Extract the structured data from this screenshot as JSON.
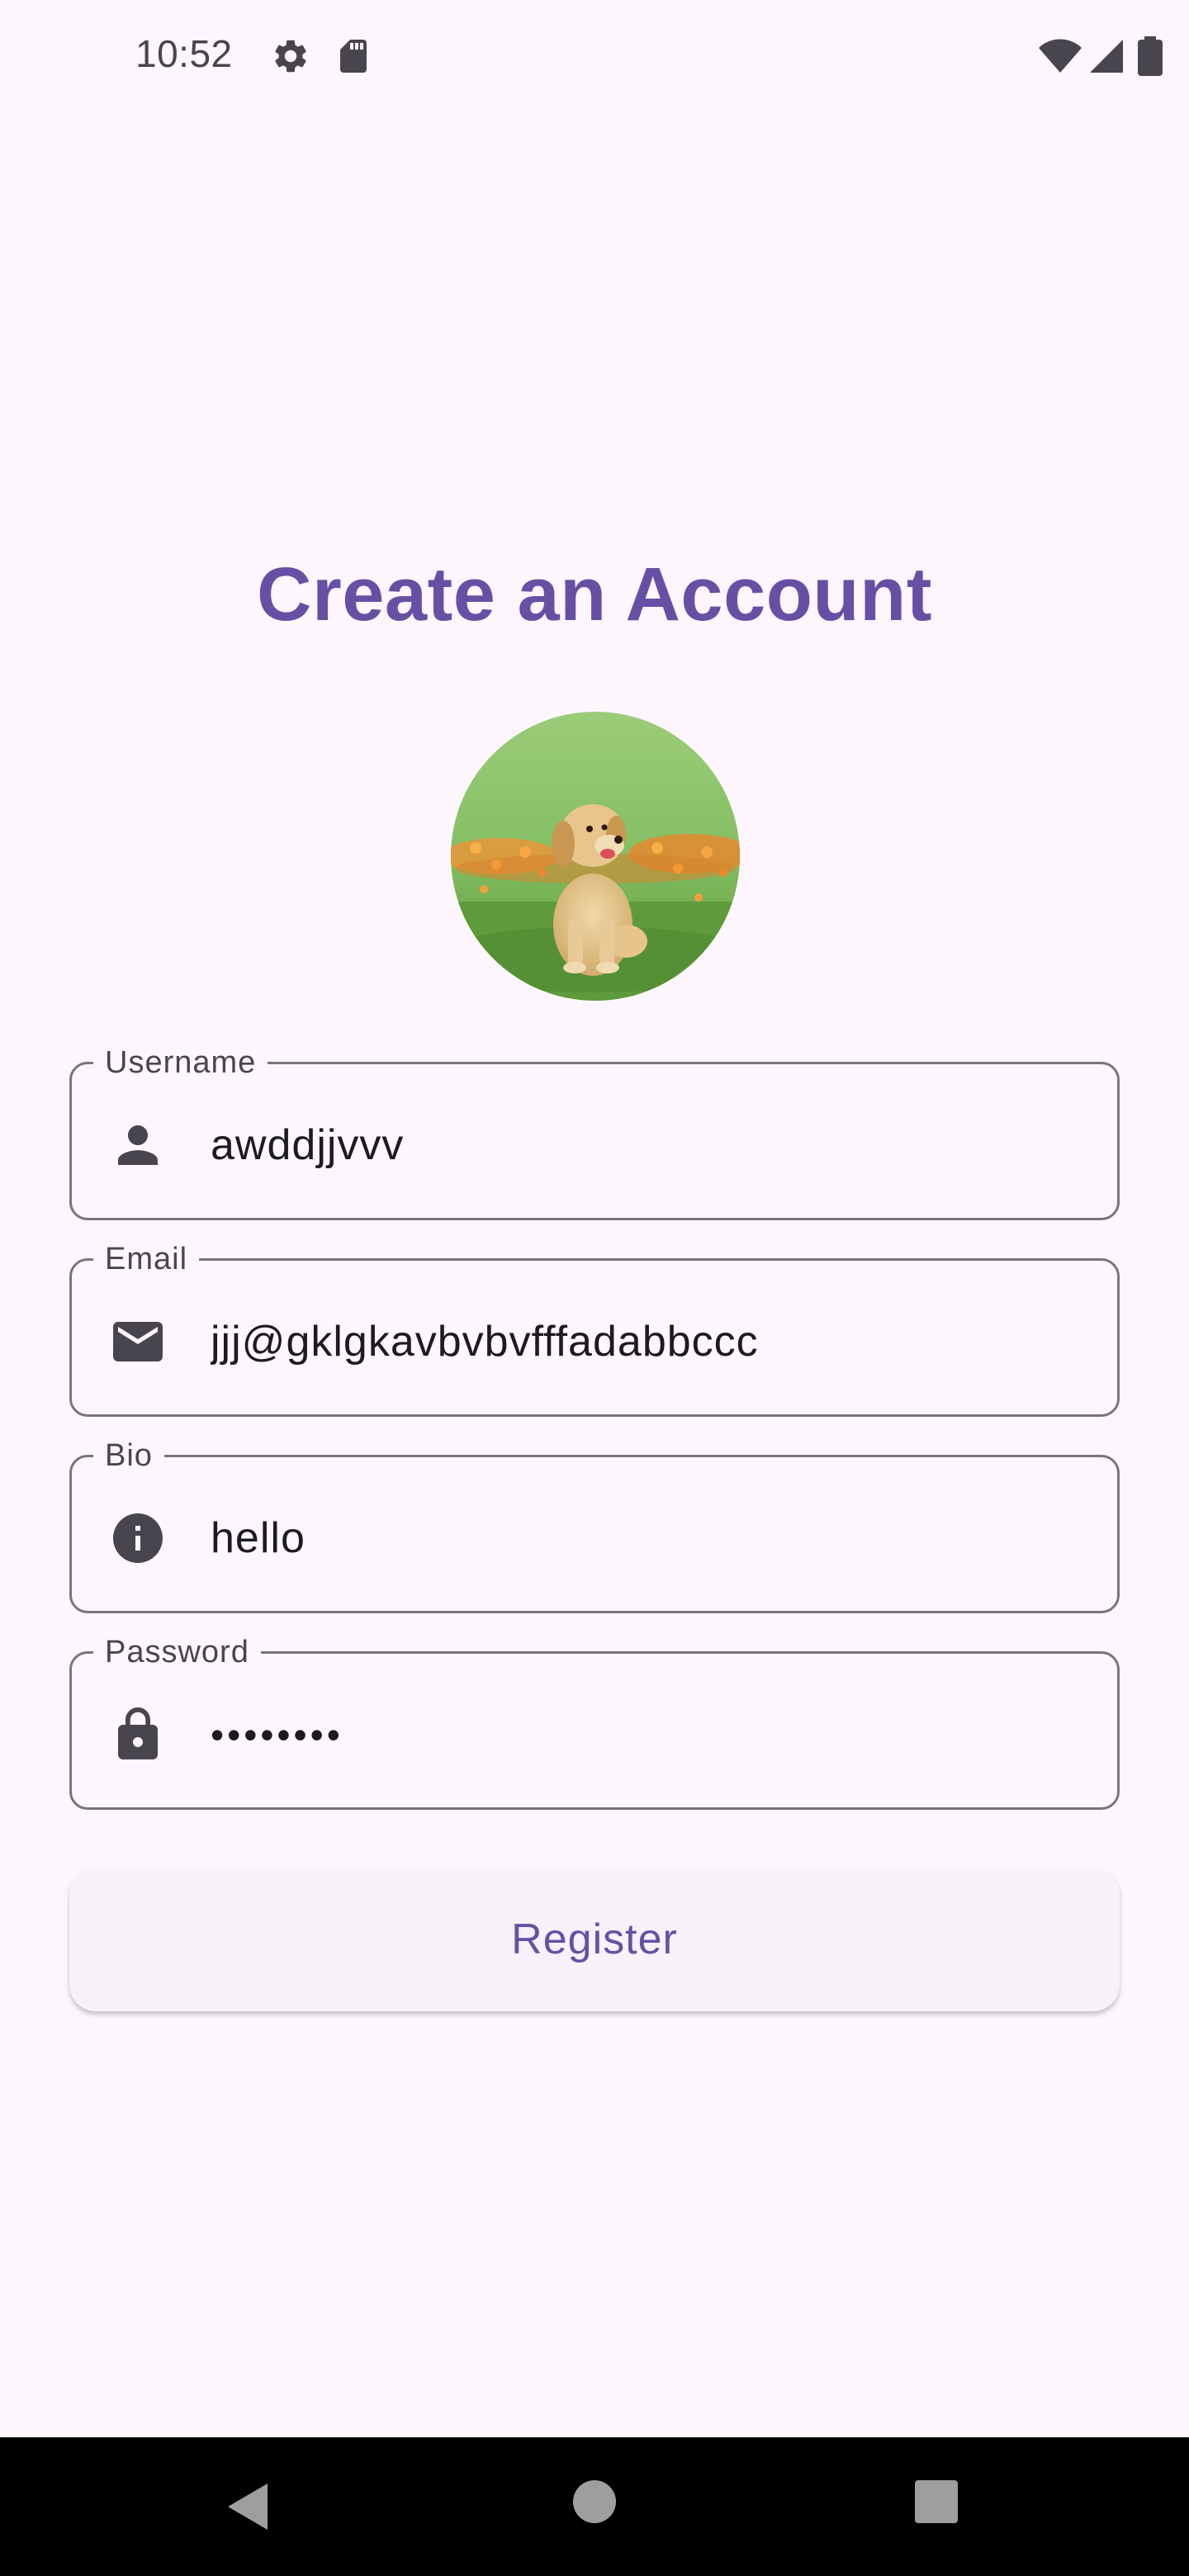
{
  "status_bar": {
    "time": "10:52",
    "left_icons": [
      "gear-icon",
      "sd-card-icon"
    ],
    "right_icons": [
      "wifi-icon",
      "signal-icon",
      "battery-icon"
    ]
  },
  "page": {
    "title": "Create an Account",
    "avatar_alt": "golden retriever puppy sitting in a flower field"
  },
  "form": {
    "username": {
      "label": "Username",
      "value": "awddjjvvv",
      "icon": "person-icon"
    },
    "email": {
      "label": "Email",
      "value": "jjj@gklgkavbvbvfffadabbccc",
      "icon": "mail-icon"
    },
    "bio": {
      "label": "Bio",
      "value": "hello",
      "icon": "info-icon"
    },
    "password": {
      "label": "Password",
      "value": "••••••••",
      "icon": "lock-icon"
    },
    "register_label": "Register"
  },
  "colors": {
    "primary": "#6750a4",
    "background": "#fdf7fd",
    "outline": "#79747e",
    "icon": "#49454f"
  },
  "nav_bar": {
    "buttons": [
      "back-triangle-icon",
      "home-circle-icon",
      "recents-square-icon"
    ]
  }
}
